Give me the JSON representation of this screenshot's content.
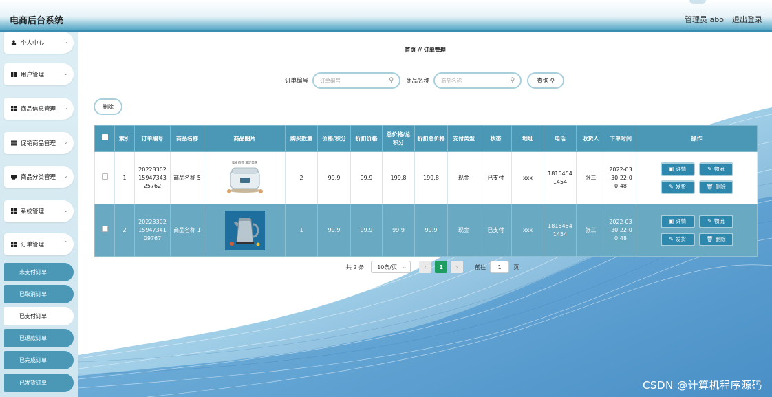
{
  "header": {
    "title": "电商后台系统",
    "user": "管理员 abo",
    "logout": "退出登录"
  },
  "sidebar": {
    "items": [
      {
        "label": "个人中心",
        "icon": "person-icon"
      },
      {
        "label": "用户管理",
        "icon": "users-icon"
      },
      {
        "label": "商品信息管理",
        "icon": "grid-icon"
      },
      {
        "label": "促销商品管理",
        "icon": "list-icon"
      },
      {
        "label": "商品分类管理",
        "icon": "tag-icon"
      },
      {
        "label": "系统管理",
        "icon": "grid-icon"
      },
      {
        "label": "订单管理",
        "icon": "grid-icon"
      }
    ],
    "subitems": [
      {
        "label": "未支付订单",
        "active": false
      },
      {
        "label": "已取消订单",
        "active": false
      },
      {
        "label": "已支付订单",
        "active": true
      },
      {
        "label": "已退款订单",
        "active": false
      },
      {
        "label": "已完成订单",
        "active": false
      },
      {
        "label": "已发货订单",
        "active": false
      }
    ]
  },
  "breadcrumb": "首页  //  订单管理",
  "search": {
    "order_label": "订单编号",
    "order_placeholder": "订单编号",
    "product_label": "商品名称",
    "product_placeholder": "商品名称",
    "query_label": "查询 ⚲"
  },
  "delete_button": "删除",
  "table": {
    "headers": [
      "索引",
      "订单编号",
      "商品名称",
      "商品图片",
      "购买数量",
      "价格/积分",
      "折扣价格",
      "总价格/总积分",
      "折扣总价格",
      "支付类型",
      "状态",
      "地址",
      "电话",
      "收货人",
      "下单时间",
      "操作"
    ],
    "rows": [
      {
        "index": "1",
        "order_no": "20223302 15947343 25762",
        "product": "商品名称 5",
        "qty": "2",
        "price": "99.9",
        "discount": "99.9",
        "total": "199.8",
        "discount_total": "199.8",
        "pay_type": "现金",
        "status": "已支付",
        "address": "xxx",
        "phone": "1815454 1454",
        "receiver": "张三",
        "time": "2022-03 -30 22:0 0:48",
        "image_text": "美食首选 满足需求"
      },
      {
        "index": "2",
        "order_no": "20223302 15947341 09767",
        "product": "商品名称 1",
        "qty": "1",
        "price": "99.9",
        "discount": "99.9",
        "total": "99.9",
        "discount_total": "99.9",
        "pay_type": "现金",
        "status": "已支付",
        "address": "xxx",
        "phone": "1815454 1454",
        "receiver": "张三",
        "time": "2022-03 -30 22:0 0:48"
      }
    ],
    "ops": {
      "detail": "详情",
      "logistics": "物流",
      "ship": "发货",
      "delete": "删除"
    }
  },
  "pagination": {
    "total": "共 2 条",
    "page_size": "10条/页",
    "current": "1",
    "goto_label": "前往",
    "goto_value": "1",
    "page_suffix": "页"
  },
  "watermark": "CSDN @计算机程序源码",
  "colors": {
    "primary": "#4a98b6",
    "accent": "#2e88ad",
    "current_page": "#1e9e5e"
  }
}
